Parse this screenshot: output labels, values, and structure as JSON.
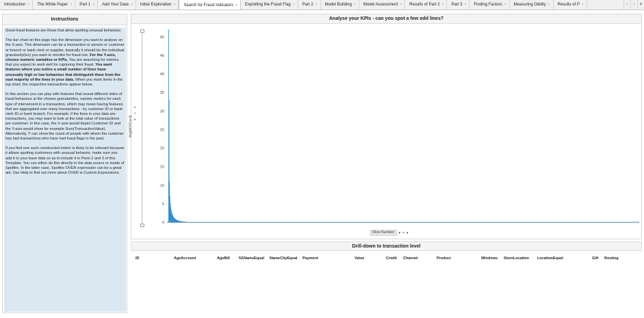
{
  "tabs": [
    {
      "label": "Introduction",
      "active": false
    },
    {
      "label": "The White Paper",
      "active": false
    },
    {
      "label": "Part 1",
      "active": false
    },
    {
      "label": "Add Your Data",
      "active": false
    },
    {
      "label": "Initial Exploration",
      "active": false
    },
    {
      "label": "Search for Fraud Indicators",
      "active": true
    },
    {
      "label": "Exploiting the Fraud Flag",
      "active": false
    },
    {
      "label": "Part 2",
      "active": false
    },
    {
      "label": "Model Building",
      "active": false
    },
    {
      "label": "Model Assessment",
      "active": false
    },
    {
      "label": "Results of Part 2",
      "active": false
    },
    {
      "label": "Part 3",
      "active": false
    },
    {
      "label": "Finding Factors",
      "active": false
    },
    {
      "label": "Measuring Oddity",
      "active": false
    },
    {
      "label": "Results of P",
      "active": false
    }
  ],
  "tab_close_glyph": "×",
  "tab_nav": [
    "‹",
    "›",
    "▾"
  ],
  "instructions": {
    "title": "Instructions",
    "p1": "Good fraud features are those that allow spotting unusual behaviour.",
    "p2_a": "The bar chart on this page has the dimension you want to analyse on the X-axis. This dimension can be a transaction or person or customer or branch or bank clerk or supplier, basically it should be the individual granularity(ies) you want to monitor for fraud risk. ",
    "p2_b": "For the Y-axis, choose numeric variables or KPIs.",
    "p2_c": " You are searching for metrics that you expect to work well for capturing their fraud. ",
    "p2_d": "You want features where you notice a small number of lines have unusually high or low behaviour that distinguish them from the vast majority of the lines in your data.",
    "p2_e": " When you mark items in the top chart, the respective transactions appear below.",
    "p3": "In this section you can play with features that reveal different sides of fraud behaviour at the chosen granularities, namely metrics for each type of intervenient in a transaction, which may mean having features that are aggregated over many transactions - by customer ID or bank clerk ID or bank branch. For example, if the lines in your data are transactions, you may want to look at the total value of transactions per customer; in this case, the X-axis would depict Customer ID and the Y-axis would show for example Sum(TransactionValue). Alternatively, Y can show the count of people with whom the customer has had transactions who have had fraud flags in the past.",
    "p4": "If you find one such constructed metric is likely to be relevant because it allows spotting customers with unusual behavior, make sure you add it to your base data so as to include it in Parts 2 and 3 of this Template. You can either do this directly in the data source or inside of Spotfire. In the latter case, Spotfire OVER expression can be a great aid. Use Help to find out more about OVER is Custom Expressions."
  },
  "chart": {
    "header": "Analyse your KPIs - can you spot a few odd lines?",
    "y_axis_label": "Avg(M24Card)",
    "y_controls": [
      "▸",
      "+",
      "▸"
    ],
    "x_axis_label": "(Row Number)",
    "x_controls": [
      "▾",
      "+",
      "▾"
    ]
  },
  "chart_data": {
    "type": "bar",
    "ylim": [
      0,
      52
    ],
    "yticks": [
      0,
      5,
      10,
      15,
      20,
      25,
      30,
      35,
      40,
      45,
      50
    ],
    "ytick_labels": [
      "0",
      "5",
      "10",
      "15",
      "20",
      "25",
      "30",
      "35",
      "40",
      "45",
      "50"
    ],
    "xlabel": "(Row Number)",
    "ylabel": "Avg(M24Card)",
    "values": [
      52,
      33,
      11,
      7,
      5.2,
      4.1,
      3.4,
      2.9,
      2.5,
      2.1,
      1.8,
      1.6,
      1.4,
      1.25,
      1.1,
      1.0,
      0.9,
      0.82,
      0.75,
      0.68,
      0.62,
      0.56,
      0.51,
      0.47,
      0.43,
      0.4,
      0.37,
      0.34,
      0.31,
      0.29,
      0.27,
      0.25,
      0.23,
      0.21,
      0.2,
      0.19,
      0.18,
      0.17,
      0.16,
      0.15,
      0.14,
      0.13,
      0.12,
      0.11,
      0.1
    ],
    "baseline_value": 0.06,
    "color": "#2e8fd6",
    "grid": false
  },
  "drilldown": {
    "header": "Drill-down to transaction level",
    "columns": [
      "ID",
      "AgeAccount",
      "AgeBill",
      "N1NameEqual",
      "NameCityEqual",
      "Payment",
      "Value",
      "Credit",
      "Channel",
      "Product",
      "Windows",
      "StoreLocation",
      "LocationEqual",
      "Gift",
      "Routing"
    ]
  }
}
